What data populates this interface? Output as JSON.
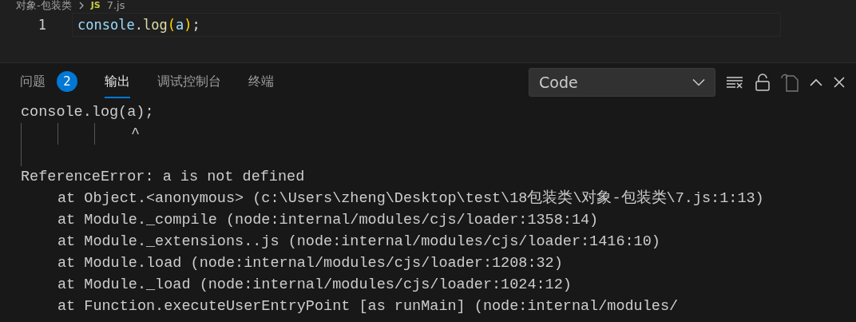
{
  "breadcrumb": {
    "folder": "对象-包装类",
    "file_badge": "JS",
    "file": "7.js"
  },
  "editor": {
    "lines": [
      {
        "number": "1",
        "tokens": [
          {
            "kind": "variable",
            "text": "console"
          },
          {
            "kind": "punct",
            "text": "."
          },
          {
            "kind": "function",
            "text": "log"
          },
          {
            "kind": "bracket",
            "text": "("
          },
          {
            "kind": "variable",
            "text": "a"
          },
          {
            "kind": "bracket",
            "text": ")"
          },
          {
            "kind": "punct",
            "text": ";"
          }
        ]
      }
    ]
  },
  "panel": {
    "tabs": [
      {
        "label": "问题",
        "badge": "2",
        "selected": false
      },
      {
        "label": "输出",
        "selected": true
      },
      {
        "label": "调试控制台",
        "selected": false
      },
      {
        "label": "终端",
        "selected": false
      }
    ],
    "channel_select": {
      "value": "Code"
    },
    "output": [
      {
        "kind": "code",
        "text": "console.log(a);"
      },
      {
        "kind": "caret",
        "text": "^"
      },
      {
        "kind": "blank"
      },
      {
        "kind": "error",
        "text": "ReferenceError: a is not defined"
      },
      {
        "kind": "frame",
        "text": "at Object.<anonymous> (c:\\Users\\zheng\\Desktop\\test\\18包装类\\对象-包装类\\7.js:1:13)"
      },
      {
        "kind": "frame",
        "text": "at Module._compile (node:internal/modules/cjs/loader:1358:14)"
      },
      {
        "kind": "frame",
        "text": "at Module._extensions..js (node:internal/modules/cjs/loader:1416:10)"
      },
      {
        "kind": "frame",
        "text": "at Module.load (node:internal/modules/cjs/loader:1208:32)"
      },
      {
        "kind": "frame",
        "text": "at Module._load (node:internal/modules/cjs/loader:1024:12)"
      },
      {
        "kind": "frame",
        "text": "at Function.executeUserEntryPoint [as runMain] (node:internal/modules/"
      }
    ]
  }
}
